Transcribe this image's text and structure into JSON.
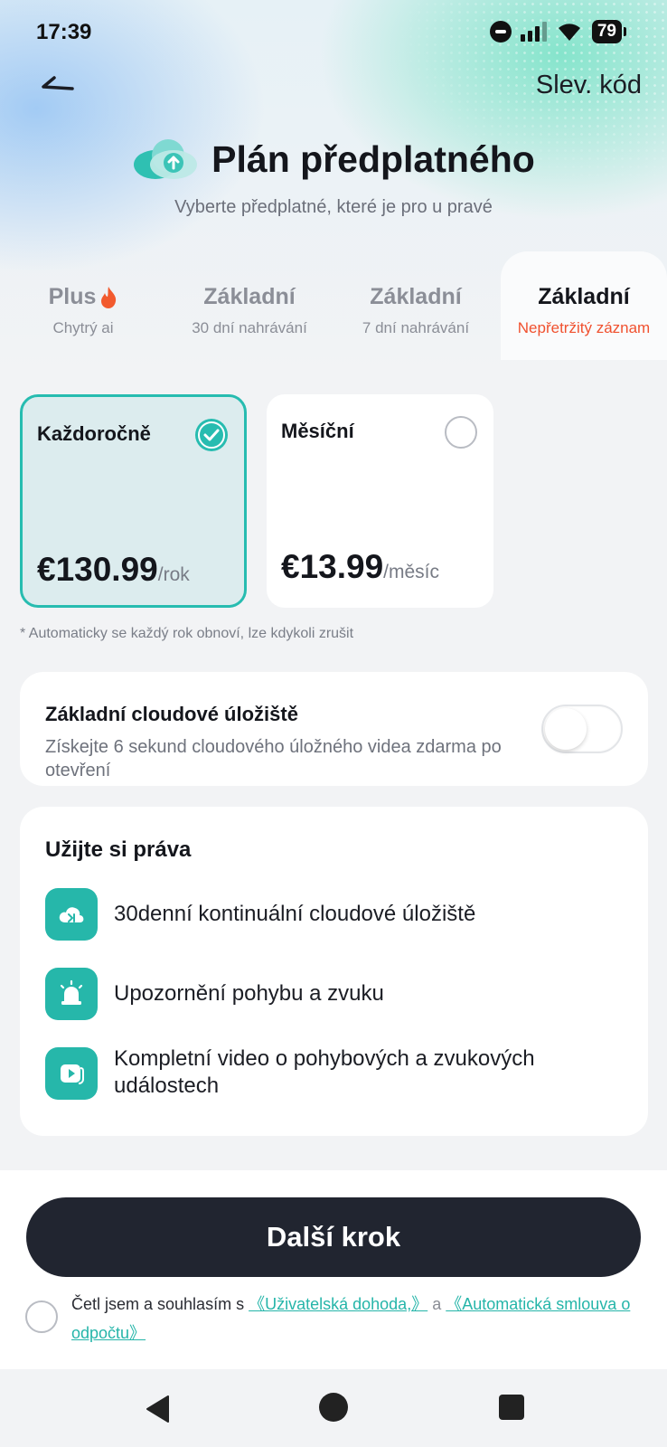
{
  "status_bar": {
    "time": "17:39",
    "battery": "79"
  },
  "header": {
    "promo_code": "Slev. kód",
    "title": "Plán předplatného",
    "subtitle": "Vyberte předplatné, které je pro u pravé"
  },
  "tabs": [
    {
      "title": "Plus",
      "subtitle": "Chytrý ai",
      "icon": "fire-icon"
    },
    {
      "title": "Základní",
      "subtitle": "30 dní nahrávání"
    },
    {
      "title": "Základní",
      "subtitle": "7 dní nahrávání"
    },
    {
      "title": "Základní",
      "subtitle": "Nepřetržitý záznam",
      "active": true
    }
  ],
  "plans": [
    {
      "name": "Každoročně",
      "price": "€130.99",
      "period": "/rok",
      "selected": true
    },
    {
      "name": "Měsíční",
      "price": "€13.99",
      "period": "/měsíc",
      "selected": false
    }
  ],
  "renew_note": "* Automaticky se každý rok obnoví, lze kdykoli zrušit",
  "cloud_storage": {
    "title": "Základní cloudové úložiště",
    "description": "Získejte 6 sekund cloudového úložného videa zdarma po otevření",
    "enabled": false
  },
  "benefits": {
    "title": "Užijte si práva",
    "items": [
      {
        "label": "30denní kontinuální cloudové úložiště",
        "icon": "cloud-storage-icon"
      },
      {
        "label": "Upozornění pohybu a zvuku",
        "icon": "alarm-icon"
      },
      {
        "label": "Kompletní video o pohybových a zvukových událostech",
        "icon": "video-play-icon"
      }
    ]
  },
  "footer": {
    "next_button": "Další krok",
    "agree_text": "Četl jsem a souhlasím s",
    "user_agreement_link": "《Uživatelská dohoda,》",
    "and_text": "a",
    "auto_debit_link": "《Automatická smlouva o odpočtu》"
  },
  "colors": {
    "accent": "#27bcb0",
    "button_dark": "#212530",
    "tab_active_sub": "#f0512f"
  }
}
